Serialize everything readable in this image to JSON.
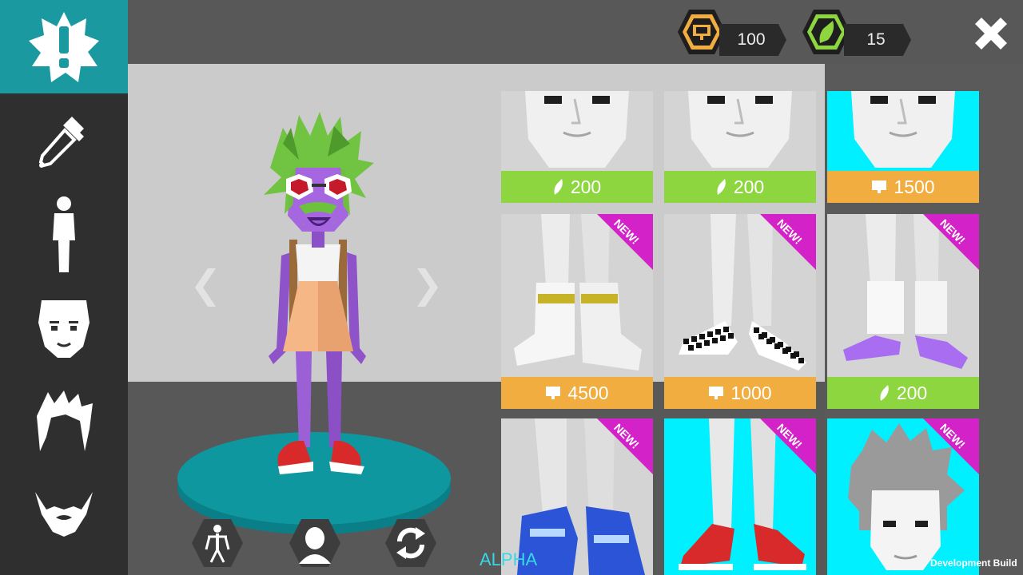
{
  "sidebar": {
    "items": [
      {
        "icon": "alert-badge-icon",
        "active": true
      },
      {
        "icon": "eyedropper-icon",
        "active": false
      },
      {
        "icon": "body-icon",
        "active": false
      },
      {
        "icon": "face-icon",
        "active": false
      },
      {
        "icon": "hair-icon",
        "active": false
      },
      {
        "icon": "beard-icon",
        "active": false
      }
    ]
  },
  "currency": {
    "coins": {
      "icon": "coin-icon",
      "value": "100",
      "color": "#f2ad40"
    },
    "gems": {
      "icon": "leaf-gem-icon",
      "value": "15",
      "color": "#8ed63f"
    }
  },
  "stage": {
    "left_arrow": "‹",
    "right_arrow": "›",
    "bottom_buttons": [
      {
        "icon": "skeleton-icon"
      },
      {
        "icon": "head-silhouette-icon"
      },
      {
        "icon": "rotate-icon"
      }
    ]
  },
  "shop": {
    "items": [
      {
        "label": "",
        "price": "200",
        "currency": "gem",
        "new": false,
        "preview": "face-preview"
      },
      {
        "label": "",
        "price": "200",
        "currency": "gem",
        "new": false,
        "preview": "face-preview"
      },
      {
        "label": "",
        "price": "1500",
        "currency": "coin",
        "new": false,
        "preview": "face-preview"
      },
      {
        "label": "",
        "price": "4500",
        "currency": "coin",
        "new": true,
        "preview": "white-boots"
      },
      {
        "label": "",
        "price": "1000",
        "currency": "coin",
        "new": true,
        "preview": "checker-shoes"
      },
      {
        "label": "",
        "price": "200",
        "currency": "gem",
        "new": true,
        "preview": "purple-shoes"
      },
      {
        "label": "",
        "price": "",
        "currency": "",
        "new": true,
        "preview": "blue-sneakers"
      },
      {
        "label": "",
        "price": "",
        "currency": "",
        "new": true,
        "preview": "red-sneakers"
      },
      {
        "label": "",
        "price": "",
        "currency": "",
        "new": true,
        "preview": "spiky-hair"
      }
    ],
    "new_label": "NEW!"
  },
  "overlay": {
    "alpha": "ALPHA",
    "dev_build": "Development Build"
  },
  "colors": {
    "accent_teal": "#1a9aa0",
    "price_green": "#8ed63f",
    "price_orange": "#f2ad40",
    "ribbon_magenta": "#d322c8",
    "cyan_bg": "#00f0ff"
  }
}
